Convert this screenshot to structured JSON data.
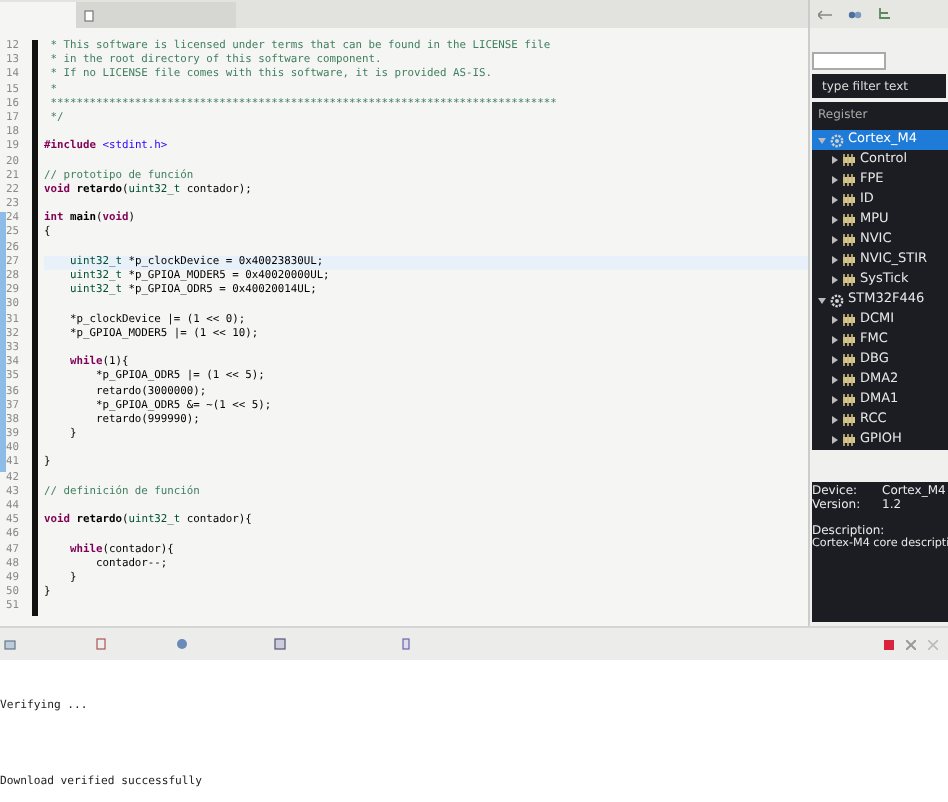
{
  "editor": {
    "lines": [
      {
        "number": "12",
        "current": false,
        "marked": false,
        "tokens": [
          {
            "kind": "comment",
            "text": " * This software is licensed under terms that can be found in the LICENSE file"
          }
        ]
      },
      {
        "number": "13",
        "current": false,
        "marked": false,
        "tokens": [
          {
            "kind": "comment",
            "text": " * in the root directory of this software component."
          }
        ]
      },
      {
        "number": "14",
        "current": false,
        "marked": false,
        "tokens": [
          {
            "kind": "comment",
            "text": " * If no LICENSE file comes with this software, it is provided AS-IS."
          }
        ]
      },
      {
        "number": "15",
        "current": false,
        "marked": false,
        "tokens": [
          {
            "kind": "comment",
            "text": " *"
          }
        ]
      },
      {
        "number": "16",
        "current": false,
        "marked": false,
        "tokens": [
          {
            "kind": "comment",
            "text": " ******************************************************************************"
          }
        ]
      },
      {
        "number": "17",
        "current": false,
        "marked": false,
        "tokens": [
          {
            "kind": "comment",
            "text": " */"
          }
        ]
      },
      {
        "number": "18",
        "current": false,
        "marked": false
      },
      {
        "number": "19",
        "current": false,
        "marked": false,
        "tokens": [
          {
            "kind": "keyword",
            "text": "#include"
          },
          {
            "kind": "string",
            "text": " <stdint.h>"
          }
        ]
      },
      {
        "number": "20",
        "current": false,
        "marked": false
      },
      {
        "number": "21",
        "current": false,
        "marked": false,
        "tokens": [
          {
            "kind": "comment",
            "text": "// prototipo de función"
          }
        ]
      },
      {
        "number": "22",
        "current": false,
        "marked": false,
        "tokens": [
          {
            "kind": "keyword",
            "text": "void"
          },
          {
            "kind": "function",
            "text": " retardo"
          },
          {
            "kind": "plain",
            "text": "("
          },
          {
            "kind": "type",
            "text": "uint32_t"
          },
          {
            "kind": "plain",
            "text": " contador);"
          }
        ]
      },
      {
        "number": "23",
        "current": false,
        "marked": false
      },
      {
        "number": "24",
        "current": false,
        "marked": true,
        "tokens": [
          {
            "kind": "keyword",
            "text": "int"
          },
          {
            "kind": "function",
            "text": " main"
          },
          {
            "kind": "plain",
            "text": "("
          },
          {
            "kind": "keyword",
            "text": "void"
          },
          {
            "kind": "plain",
            "text": ")"
          }
        ]
      },
      {
        "number": "25",
        "current": false,
        "marked": true,
        "tokens": [
          {
            "kind": "plain",
            "text": "{"
          }
        ]
      },
      {
        "number": "26",
        "current": false,
        "marked": true
      },
      {
        "number": "27",
        "current": true,
        "marked": true,
        "tokens": [
          {
            "kind": "type",
            "text": "    uint32_t"
          },
          {
            "kind": "plain",
            "text": " *p_clockDevice = 0x40023830UL;"
          }
        ]
      },
      {
        "number": "28",
        "current": false,
        "marked": true,
        "tokens": [
          {
            "kind": "type",
            "text": "    uint32_t"
          },
          {
            "kind": "plain",
            "text": " *p_GPIOA_MODER5 = 0x40020000UL;"
          }
        ]
      },
      {
        "number": "29",
        "current": false,
        "marked": true,
        "tokens": [
          {
            "kind": "type",
            "text": "    uint32_t"
          },
          {
            "kind": "plain",
            "text": " *p_GPIOA_ODR5 = 0x40020014UL;"
          }
        ]
      },
      {
        "number": "30",
        "current": false,
        "marked": true
      },
      {
        "number": "31",
        "current": false,
        "marked": true,
        "tokens": [
          {
            "kind": "plain",
            "text": "    *p_clockDevice |= (1 << 0);"
          }
        ]
      },
      {
        "number": "32",
        "current": false,
        "marked": true,
        "tokens": [
          {
            "kind": "plain",
            "text": "    *p_GPIOA_MODER5 |= (1 << 10);"
          }
        ]
      },
      {
        "number": "33",
        "current": false,
        "marked": true
      },
      {
        "number": "34",
        "current": false,
        "marked": true,
        "tokens": [
          {
            "kind": "keyword",
            "text": "    while"
          },
          {
            "kind": "plain",
            "text": "(1){"
          }
        ]
      },
      {
        "number": "35",
        "current": false,
        "marked": true,
        "tokens": [
          {
            "kind": "plain",
            "text": "        *p_GPIOA_ODR5 |= (1 << 5);"
          }
        ]
      },
      {
        "number": "36",
        "current": false,
        "marked": true,
        "tokens": [
          {
            "kind": "plain",
            "text": "        retardo(3000000);"
          }
        ]
      },
      {
        "number": "37",
        "current": false,
        "marked": true,
        "tokens": [
          {
            "kind": "plain",
            "text": "        *p_GPIOA_ODR5 &= ~(1 << 5);"
          }
        ]
      },
      {
        "number": "38",
        "current": false,
        "marked": true,
        "tokens": [
          {
            "kind": "plain",
            "text": "        retardo(999990);"
          }
        ]
      },
      {
        "number": "39",
        "current": false,
        "marked": true,
        "tokens": [
          {
            "kind": "plain",
            "text": "    }"
          }
        ]
      },
      {
        "number": "40",
        "current": false,
        "marked": true
      },
      {
        "number": "41",
        "current": false,
        "marked": true,
        "tokens": [
          {
            "kind": "plain",
            "text": "}"
          }
        ]
      },
      {
        "number": "42",
        "current": false,
        "marked": false
      },
      {
        "number": "43",
        "current": false,
        "marked": false,
        "tokens": [
          {
            "kind": "comment",
            "text": "// definición de función"
          }
        ]
      },
      {
        "number": "44",
        "current": false,
        "marked": false
      },
      {
        "number": "45",
        "current": false,
        "marked": false,
        "tokens": [
          {
            "kind": "keyword",
            "text": "void"
          },
          {
            "kind": "function",
            "text": " retardo"
          },
          {
            "kind": "plain",
            "text": "("
          },
          {
            "kind": "type",
            "text": "uint32_t"
          },
          {
            "kind": "plain",
            "text": " contador){"
          }
        ]
      },
      {
        "number": "46",
        "current": false,
        "marked": false
      },
      {
        "number": "47",
        "current": false,
        "marked": false,
        "tokens": [
          {
            "kind": "keyword",
            "text": "    while"
          },
          {
            "kind": "plain",
            "text": "(contador){"
          }
        ]
      },
      {
        "number": "48",
        "current": false,
        "marked": false,
        "tokens": [
          {
            "kind": "plain",
            "text": "        contador--;"
          }
        ]
      },
      {
        "number": "49",
        "current": false,
        "marked": false,
        "tokens": [
          {
            "kind": "plain",
            "text": "    }"
          }
        ]
      },
      {
        "number": "50",
        "current": false,
        "marked": false,
        "tokens": [
          {
            "kind": "plain",
            "text": "}"
          }
        ]
      },
      {
        "number": "51",
        "current": false,
        "marked": false
      }
    ]
  },
  "registers": {
    "filter": {
      "placeholder": "type filter text"
    },
    "header": "Register",
    "tree": [
      {
        "label": "Cortex_M4",
        "kind": "device",
        "selected": true,
        "expanded": true,
        "children": [
          {
            "label": "Control",
            "kind": "peripheral",
            "selected": false,
            "expanded": false
          },
          {
            "label": "FPE",
            "kind": "peripheral",
            "selected": false,
            "expanded": false
          },
          {
            "label": "ID",
            "kind": "peripheral",
            "selected": false,
            "expanded": false
          },
          {
            "label": "MPU",
            "kind": "peripheral",
            "selected": false,
            "expanded": false
          },
          {
            "label": "NVIC",
            "kind": "peripheral",
            "selected": false,
            "expanded": false
          },
          {
            "label": "NVIC_STIR",
            "kind": "peripheral",
            "selected": false,
            "expanded": false
          },
          {
            "label": "SysTick",
            "kind": "peripheral",
            "selected": false,
            "expanded": false
          }
        ]
      },
      {
        "label": "STM32F446",
        "kind": "device",
        "selected": false,
        "expanded": true,
        "children": [
          {
            "label": "DCMI",
            "kind": "peripheral",
            "selected": false,
            "expanded": false
          },
          {
            "label": "FMC",
            "kind": "peripheral",
            "selected": false,
            "expanded": false
          },
          {
            "label": "DBG",
            "kind": "peripheral",
            "selected": false,
            "expanded": false
          },
          {
            "label": "DMA2",
            "kind": "peripheral",
            "selected": false,
            "expanded": false
          },
          {
            "label": "DMA1",
            "kind": "peripheral",
            "selected": false,
            "expanded": false
          },
          {
            "label": "RCC",
            "kind": "peripheral",
            "selected": false,
            "expanded": false
          },
          {
            "label": "GPIOH",
            "kind": "peripheral",
            "selected": false,
            "expanded": false
          }
        ]
      }
    ],
    "info": {
      "rows": [
        {
          "label": "Device:",
          "value": "Cortex_M4"
        },
        {
          "label": "Version:",
          "value": "1.2"
        }
      ],
      "description_label": "Description:",
      "description": "Cortex-M4 core descripti"
    }
  },
  "console": {
    "lines": [
      "Verifying ...",
      "Download verified successfully"
    ]
  }
}
